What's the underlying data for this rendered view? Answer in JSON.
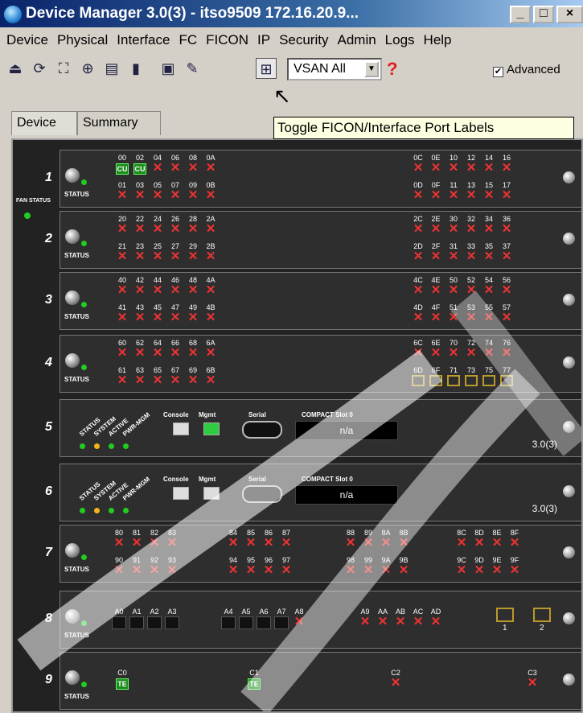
{
  "window": {
    "title": "Device Manager 3.0(3) - itso9509 172.16.20.9...",
    "btn_min": "_",
    "btn_max": "□",
    "btn_close": "×"
  },
  "menu": [
    "Device",
    "Physical",
    "Interface",
    "FC",
    "FICON",
    "IP",
    "Security",
    "Admin",
    "Logs",
    "Help"
  ],
  "toolbar": {
    "vsan_value": "VSAN All",
    "help_icon": "?",
    "advanced_label": "Advanced",
    "advanced_checked": "✔"
  },
  "tabs": [
    "Device",
    "Summary"
  ],
  "tooltip": "Toggle FICON/Interface Port Labels",
  "chassis": {
    "fan_status": "FAN STATUS",
    "status_label": "STATUS",
    "slots": [
      {
        "num": "1",
        "top_left": [
          "00",
          "02",
          "04",
          "06",
          "08",
          "0A"
        ],
        "bot_left": [
          "01",
          "03",
          "05",
          "07",
          "09",
          "0B"
        ],
        "top_right": [
          "0C",
          "0E",
          "10",
          "12",
          "14",
          "16"
        ],
        "bot_right": [
          "0D",
          "0F",
          "11",
          "13",
          "15",
          "17"
        ],
        "mark_top_left": [
          "CU",
          "CU",
          "✕",
          "✕",
          "✕",
          "✕"
        ]
      },
      {
        "num": "2",
        "top_left": [
          "20",
          "22",
          "24",
          "26",
          "28",
          "2A"
        ],
        "bot_left": [
          "21",
          "23",
          "25",
          "27",
          "29",
          "2B"
        ],
        "top_right": [
          "2C",
          "2E",
          "30",
          "32",
          "34",
          "36"
        ],
        "bot_right": [
          "2D",
          "2F",
          "31",
          "33",
          "35",
          "37"
        ]
      },
      {
        "num": "3",
        "top_left": [
          "40",
          "42",
          "44",
          "46",
          "48",
          "4A"
        ],
        "bot_left": [
          "41",
          "43",
          "45",
          "47",
          "49",
          "4B"
        ],
        "top_right": [
          "4C",
          "4E",
          "50",
          "52",
          "54",
          "56"
        ],
        "bot_right": [
          "4D",
          "4F",
          "51",
          "53",
          "55",
          "57"
        ]
      },
      {
        "num": "4",
        "top_left": [
          "60",
          "62",
          "64",
          "66",
          "68",
          "6A"
        ],
        "bot_left": [
          "61",
          "63",
          "65",
          "67",
          "69",
          "6B"
        ],
        "top_right": [
          "6C",
          "6E",
          "70",
          "72",
          "74",
          "76"
        ],
        "bot_right": [
          "6D",
          "6F",
          "71",
          "73",
          "75",
          "77"
        ]
      }
    ],
    "sup": {
      "slot5": "5",
      "slot6": "6",
      "console": "Console",
      "mgmt": "Mgmt",
      "serial": "Serial",
      "compact": "COMPACT Slot 0",
      "na": "n/a",
      "version": "3.0(3)",
      "leds": [
        "STATUS",
        "SYSTEM",
        "ACTIVE",
        "PWR-MGM"
      ]
    },
    "slot7": {
      "num": "7",
      "top": [
        [
          "80",
          "81",
          "82",
          "83"
        ],
        [
          "84",
          "85",
          "86",
          "87"
        ],
        [
          "88",
          "89",
          "8A",
          "8B"
        ],
        [
          "8C",
          "8D",
          "8E",
          "8F"
        ]
      ],
      "bot": [
        [
          "90",
          "91",
          "92",
          "93"
        ],
        [
          "94",
          "95",
          "96",
          "97"
        ],
        [
          "98",
          "99",
          "9A",
          "9B"
        ],
        [
          "9C",
          "9D",
          "9E",
          "9F"
        ]
      ]
    },
    "slot8": {
      "num": "8",
      "labels1": [
        "A0",
        "A1",
        "A2",
        "A3"
      ],
      "labels2": [
        "A4",
        "A5",
        "A6",
        "A7",
        "A8"
      ],
      "labels3": [
        "A9",
        "AA",
        "AB",
        "AC",
        "AD"
      ],
      "gb1": "1",
      "gb2": "2"
    },
    "slot9": {
      "num": "9",
      "ports": [
        "C0",
        "C1",
        "C2",
        "C3"
      ],
      "te": "TE"
    }
  }
}
